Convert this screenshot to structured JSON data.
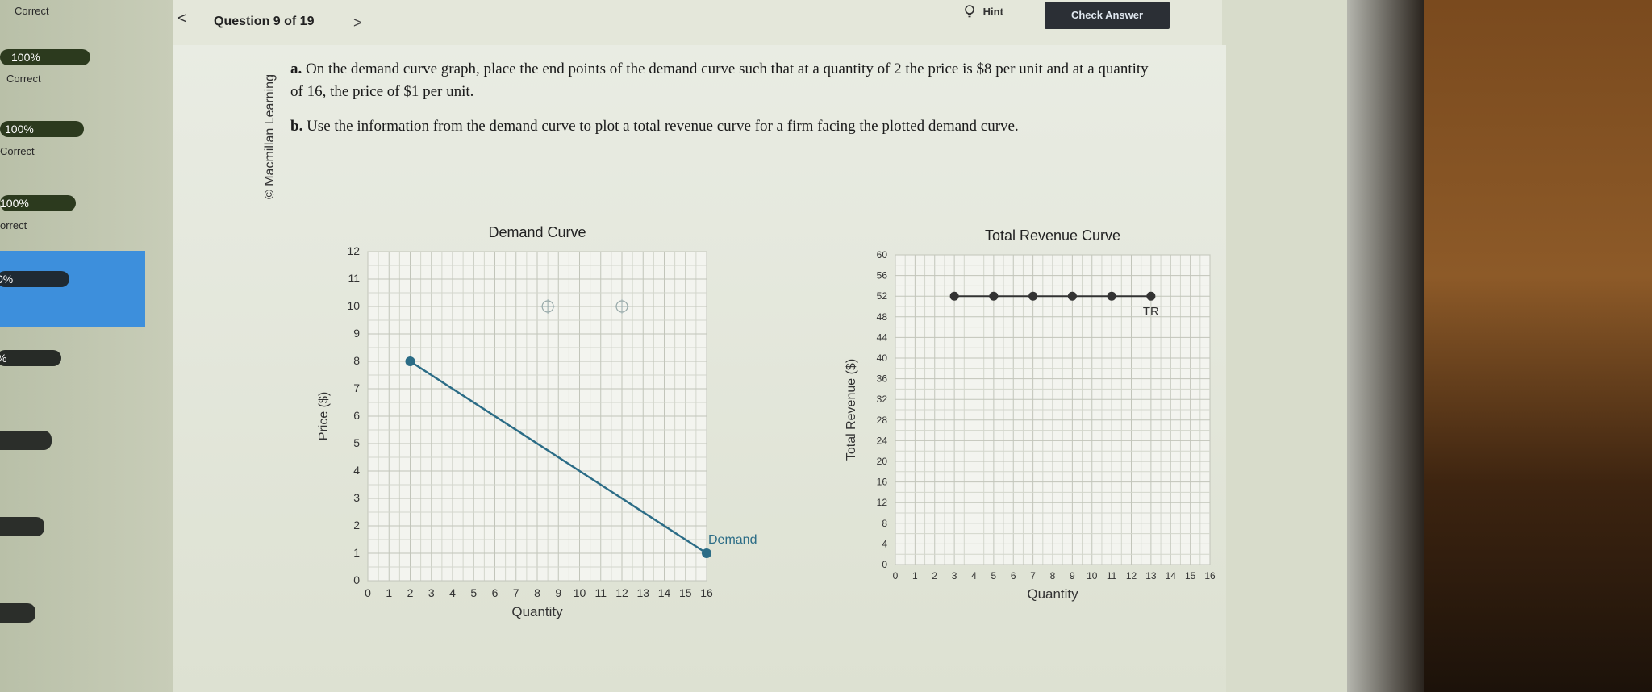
{
  "sidebar": {
    "items": [
      {
        "percent": "100%",
        "status": "Correct"
      },
      {
        "percent": "100%",
        "status": "Correct"
      },
      {
        "percent": "100%",
        "status": "Correct"
      },
      {
        "percent": "100%",
        "status": "orrect"
      },
      {
        "percent": "0%",
        "status": ""
      },
      {
        "percent": "%",
        "status": ""
      }
    ],
    "top_status": "Correct"
  },
  "header": {
    "prev_icon": "chevron-left-icon",
    "prev_symbol": "<",
    "question_label": "Question 9 of 19",
    "next_icon": "chevron-right-icon",
    "next_symbol": ">",
    "hint_label": "Hint",
    "check_answer_label": "Check Answer"
  },
  "content": {
    "copyright": "© Macmillan Learning",
    "part_a_label": "a.",
    "part_a_text": "On the demand curve graph, place the end points of the demand curve such that at a quantity of 2 the price is $8 per unit and at a quantity of 16, the price of $1 per unit.",
    "part_b_label": "b.",
    "part_b_text": "Use the information from the demand curve to plot a total revenue curve for a firm facing the plotted demand curve."
  },
  "chart_data": [
    {
      "type": "line",
      "title": "Demand Curve",
      "xlabel": "Quantity",
      "ylabel": "Price ($)",
      "xlim": [
        0,
        16
      ],
      "ylim": [
        0,
        12
      ],
      "x_ticks": [
        "0",
        "1",
        "2",
        "3",
        "4",
        "5",
        "6",
        "7",
        "8",
        "9",
        "10",
        "11",
        "12",
        "13",
        "14",
        "15",
        "16"
      ],
      "y_ticks": [
        "0",
        "1",
        "2",
        "3",
        "4",
        "5",
        "6",
        "7",
        "8",
        "9",
        "10",
        "11",
        "12"
      ],
      "series": [
        {
          "name": "Demand",
          "x": [
            2,
            16
          ],
          "y": [
            8,
            1
          ],
          "color": "#2b6c86"
        }
      ],
      "handles": [
        {
          "x": 8.5,
          "y": 10
        },
        {
          "x": 12,
          "y": 10
        }
      ],
      "grid": true
    },
    {
      "type": "line",
      "title": "Total Revenue Curve",
      "xlabel": "Quantity",
      "ylabel": "Total Revenue ($)",
      "xlim": [
        0,
        16
      ],
      "ylim": [
        0,
        60
      ],
      "x_ticks": [
        "0",
        "1",
        "2",
        "3",
        "4",
        "5",
        "6",
        "7",
        "8",
        "9",
        "10",
        "11",
        "12",
        "13",
        "14",
        "15",
        "16"
      ],
      "y_ticks": [
        "0",
        "4",
        "8",
        "12",
        "16",
        "20",
        "24",
        "28",
        "32",
        "36",
        "40",
        "44",
        "48",
        "52",
        "56",
        "60"
      ],
      "series": [
        {
          "name": "TR",
          "x": [
            3,
            5,
            7,
            9,
            11,
            13
          ],
          "y": [
            52,
            52,
            52,
            52,
            52,
            52
          ],
          "color": "#333333"
        }
      ],
      "grid": true
    }
  ]
}
